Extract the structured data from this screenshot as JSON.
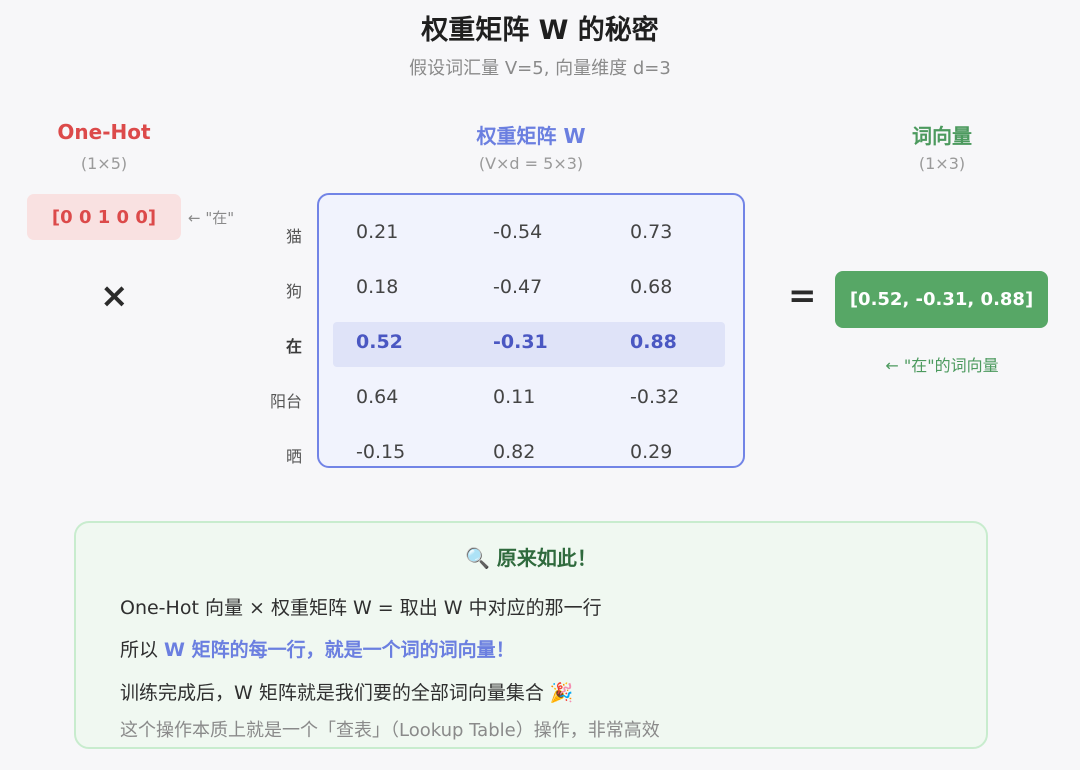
{
  "header": {
    "title": "权重矩阵 W 的秘密",
    "subtitle": "假设词汇量 V=5, 向量维度 d=3"
  },
  "onehot": {
    "label": "One-Hot",
    "shape": "(1×5)",
    "vector": "[0 0 1 0 0]",
    "note": "← \"在\"",
    "operator": "×"
  },
  "weight_matrix": {
    "label": "权重矩阵 W",
    "shape": "(V×d = 5×3)",
    "highlight_row": 2,
    "highlight_color": "#dfe3f8",
    "border_color": "#7284e6",
    "rows": [
      {
        "word": "猫",
        "values": [
          "0.21",
          "-0.54",
          "0.73"
        ]
      },
      {
        "word": "狗",
        "values": [
          "0.18",
          "-0.47",
          "0.68"
        ]
      },
      {
        "word": "在",
        "values": [
          "0.52",
          "-0.31",
          "0.88"
        ]
      },
      {
        "word": "阳台",
        "values": [
          "0.64",
          "0.11",
          "-0.32"
        ]
      },
      {
        "word": "晒",
        "values": [
          "-0.15",
          "0.82",
          "0.29"
        ]
      }
    ]
  },
  "result": {
    "label": "词向量",
    "shape": "(1×3)",
    "operator": "=",
    "vector": "[0.52, -0.31, 0.88]",
    "note": "← \"在\"的词向量",
    "color": "#57a766"
  },
  "explanation": {
    "icon": "magnifier-icon",
    "title": "🔍 原来如此！",
    "line1": "One-Hot 向量 × 权重矩阵 W = 取出 W 中对应的那一行",
    "line2_prefix": "所以 ",
    "line2_highlight": "W 矩阵的每一行，就是一个词的词向量！",
    "line3": "训练完成后，W 矩阵就是我们要的全部词向量集合 🎉",
    "note": "这个操作本质上就是一个「查表」（Lookup Table）操作，非常高效"
  }
}
